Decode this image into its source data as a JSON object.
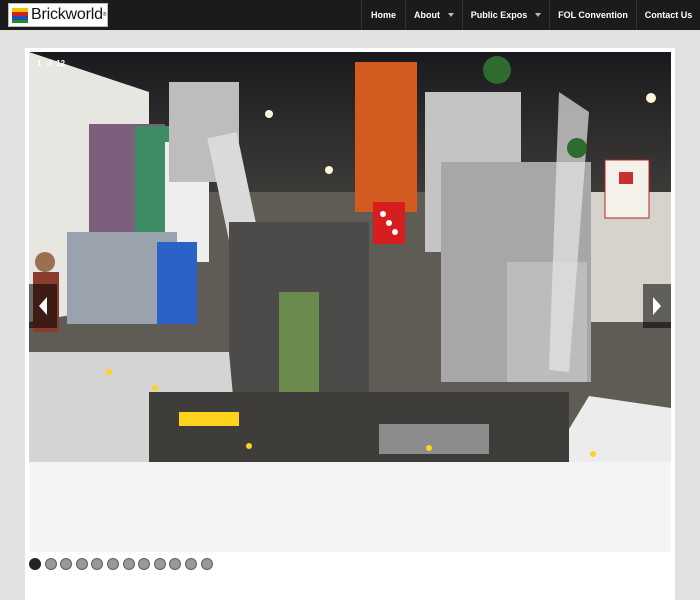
{
  "brand": {
    "name": "Brickworld",
    "registered": "®"
  },
  "nav": {
    "items": [
      {
        "label": "Home",
        "has_dropdown": false
      },
      {
        "label": "About",
        "has_dropdown": true
      },
      {
        "label": "Public Expos",
        "has_dropdown": true
      },
      {
        "label": "FOL Convention",
        "has_dropdown": false
      },
      {
        "label": "Contact Us",
        "has_dropdown": false
      }
    ]
  },
  "slider": {
    "current": "1",
    "of_label": "of",
    "total": "12",
    "active_index": 0,
    "slide_count": 12,
    "prev_icon": "chevron-left-icon",
    "next_icon": "chevron-right-icon"
  },
  "colors": {
    "topbar": "#1b1b1b",
    "page_bg": "#e2e2e2",
    "dot_active": "#222222",
    "dot_inactive": "#999999",
    "accent_red": "#d61e1e"
  }
}
